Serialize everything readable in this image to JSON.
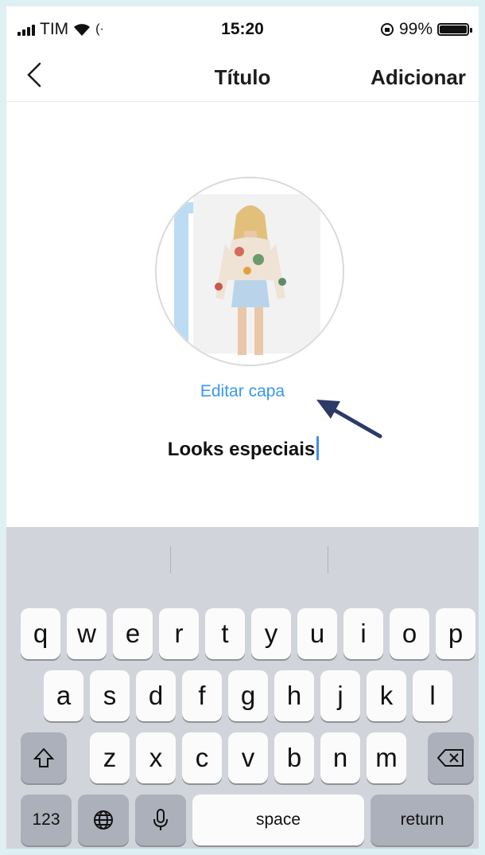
{
  "status_bar": {
    "carrier": "TIM",
    "time": "15:20",
    "battery_percent": "99%",
    "battery_level": 0.99
  },
  "nav": {
    "title": "Título",
    "add_label": "Adicionar"
  },
  "cover": {
    "edit_label": "Editar capa"
  },
  "highlight": {
    "title_value": "Looks especiais"
  },
  "keyboard": {
    "row1": [
      "q",
      "w",
      "e",
      "r",
      "t",
      "y",
      "u",
      "i",
      "o",
      "p"
    ],
    "row2": [
      "a",
      "s",
      "d",
      "f",
      "g",
      "h",
      "j",
      "k",
      "l"
    ],
    "row3": [
      "z",
      "x",
      "c",
      "v",
      "b",
      "n",
      "m"
    ],
    "numbers_label": "123",
    "space_label": "space",
    "return_label": "return"
  },
  "colors": {
    "link_blue": "#3897f0",
    "arrow_navy": "#2b3a67",
    "keyboard_bg": "#d1d4db",
    "frame_border": "#dff0f4"
  }
}
